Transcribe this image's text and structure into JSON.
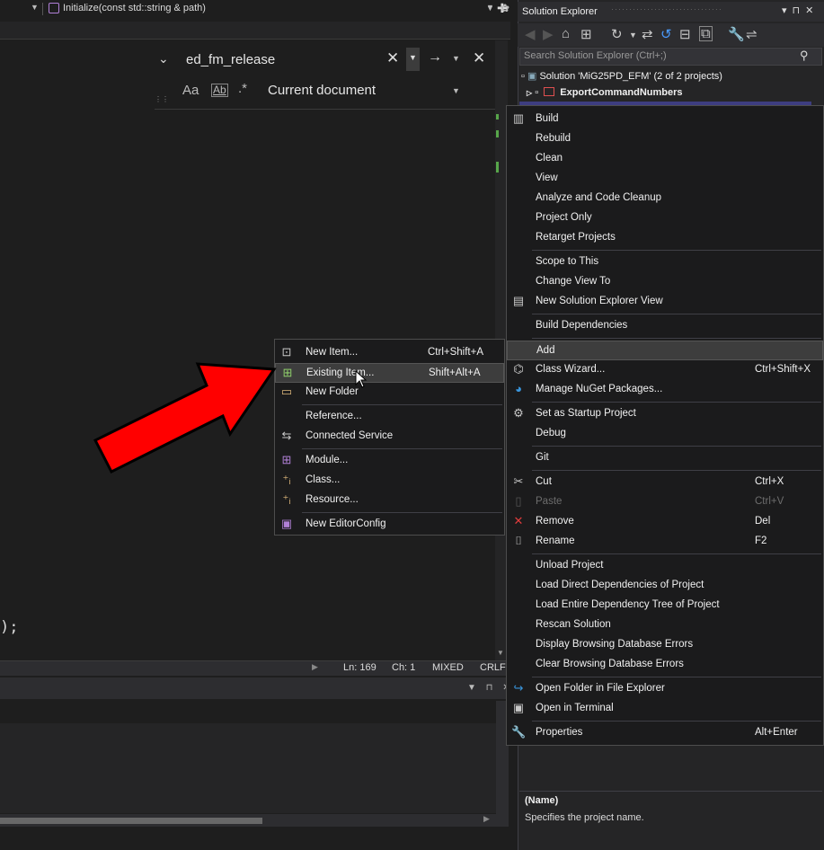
{
  "editor": {
    "nav_method": "Initialize(const std::string & path)",
    "find": {
      "search_text": "ed_fm_release",
      "close_glyph": "✕",
      "next_glyph": "→",
      "scope": "Current document",
      "opt_case": "Aa",
      "opt_word": "Ab",
      "opt_regex": ".*"
    },
    "code_fragment": ");",
    "status": {
      "line": "Ln: 169",
      "col": "Ch: 1",
      "encoding": "MIXED",
      "eol": "CRLF"
    }
  },
  "solution_explorer": {
    "title": "Solution Explorer",
    "search_placeholder": "Search Solution Explorer (Ctrl+;)",
    "solution_label": "Solution 'MiG25PD_EFM' (2 of 2 projects)",
    "project_label": "ExportCommandNumbers",
    "properties": {
      "name_label": "(Name)",
      "description": "Specifies the project name."
    }
  },
  "context_menu": {
    "items": {
      "build": "Build",
      "rebuild": "Rebuild",
      "clean": "Clean",
      "view": "View",
      "analyze": "Analyze and Code Cleanup",
      "project_only": "Project Only",
      "retarget": "Retarget Projects",
      "scope": "Scope to This",
      "change_view": "Change View To",
      "new_se_view": "New Solution Explorer View",
      "build_deps": "Build Dependencies",
      "add": "Add",
      "class_wizard": "Class Wizard...",
      "class_wizard_sc": "Ctrl+Shift+X",
      "nuget": "Manage NuGet Packages...",
      "startup": "Set as Startup Project",
      "debug": "Debug",
      "git": "Git",
      "cut": "Cut",
      "cut_sc": "Ctrl+X",
      "paste": "Paste",
      "paste_sc": "Ctrl+V",
      "remove": "Remove",
      "remove_sc": "Del",
      "rename": "Rename",
      "rename_sc": "F2",
      "unload": "Unload Project",
      "load_direct": "Load Direct Dependencies of Project",
      "load_tree": "Load Entire Dependency Tree of Project",
      "rescan": "Rescan Solution",
      "display_errors": "Display Browsing Database Errors",
      "clear_errors": "Clear Browsing Database Errors",
      "open_folder": "Open Folder in File Explorer",
      "open_terminal": "Open in Terminal",
      "properties": "Properties",
      "properties_sc": "Alt+Enter"
    }
  },
  "add_submenu": {
    "items": {
      "new_item": "New Item...",
      "new_item_sc": "Ctrl+Shift+A",
      "existing_item": "Existing Item...",
      "existing_item_sc": "Shift+Alt+A",
      "new_folder": "New Folder",
      "reference": "Reference...",
      "connected_service": "Connected Service",
      "module": "Module...",
      "class": "Class...",
      "resource": "Resource...",
      "new_editorconfig": "New EditorConfig"
    }
  },
  "colors": {
    "arrow_fill": "#ff0000",
    "menu_bg": "#1b1b1c",
    "highlight": "#3d3d3d",
    "accent_purple": "#b180d7"
  }
}
